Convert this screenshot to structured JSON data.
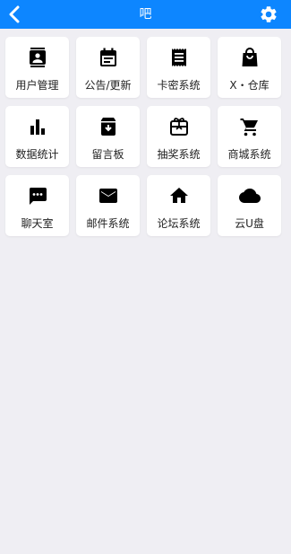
{
  "header": {
    "title": "吧",
    "background": "#0d86ff",
    "left_icon": "back-chevron-icon",
    "right_icon": "gear-icon"
  },
  "tiles": [
    {
      "label": "用户管理",
      "icon": "contacts-icon"
    },
    {
      "label": "公告/更新",
      "icon": "calendar-icon"
    },
    {
      "label": "卡密系统",
      "icon": "receipt-icon"
    },
    {
      "label": "X・仓库",
      "icon": "shopping-bag-icon"
    },
    {
      "label": "数据统计",
      "icon": "bar-chart-icon"
    },
    {
      "label": "留言板",
      "icon": "archive-download-icon"
    },
    {
      "label": "抽奖系统",
      "icon": "gift-card-icon"
    },
    {
      "label": "商城系统",
      "icon": "shopping-cart-icon"
    },
    {
      "label": "聊天室",
      "icon": "chat-bubble-icon"
    },
    {
      "label": "邮件系统",
      "icon": "mail-icon"
    },
    {
      "label": "论坛系统",
      "icon": "home-icon"
    },
    {
      "label": "云U盘",
      "icon": "cloud-icon"
    }
  ]
}
